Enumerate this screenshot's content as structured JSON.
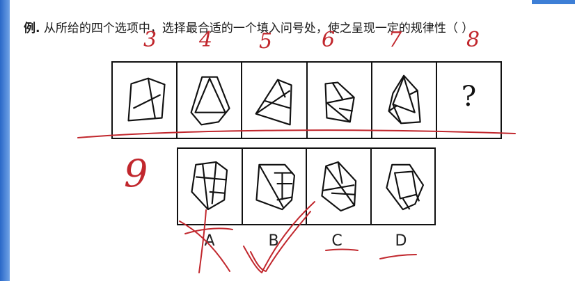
{
  "question": {
    "prefix": "例.",
    "text": "从所给的四个选项中，选择最合适的一个填入问号处，使之呈现一定的规律性（  ）"
  },
  "sequence": {
    "unknown_symbol": "?"
  },
  "options": {
    "labels": [
      "A",
      "B",
      "C",
      "D"
    ]
  },
  "annotations": {
    "numbers": [
      "3",
      "4",
      "5",
      "6",
      "7",
      "8",
      "9"
    ],
    "color": "#c1272d"
  }
}
